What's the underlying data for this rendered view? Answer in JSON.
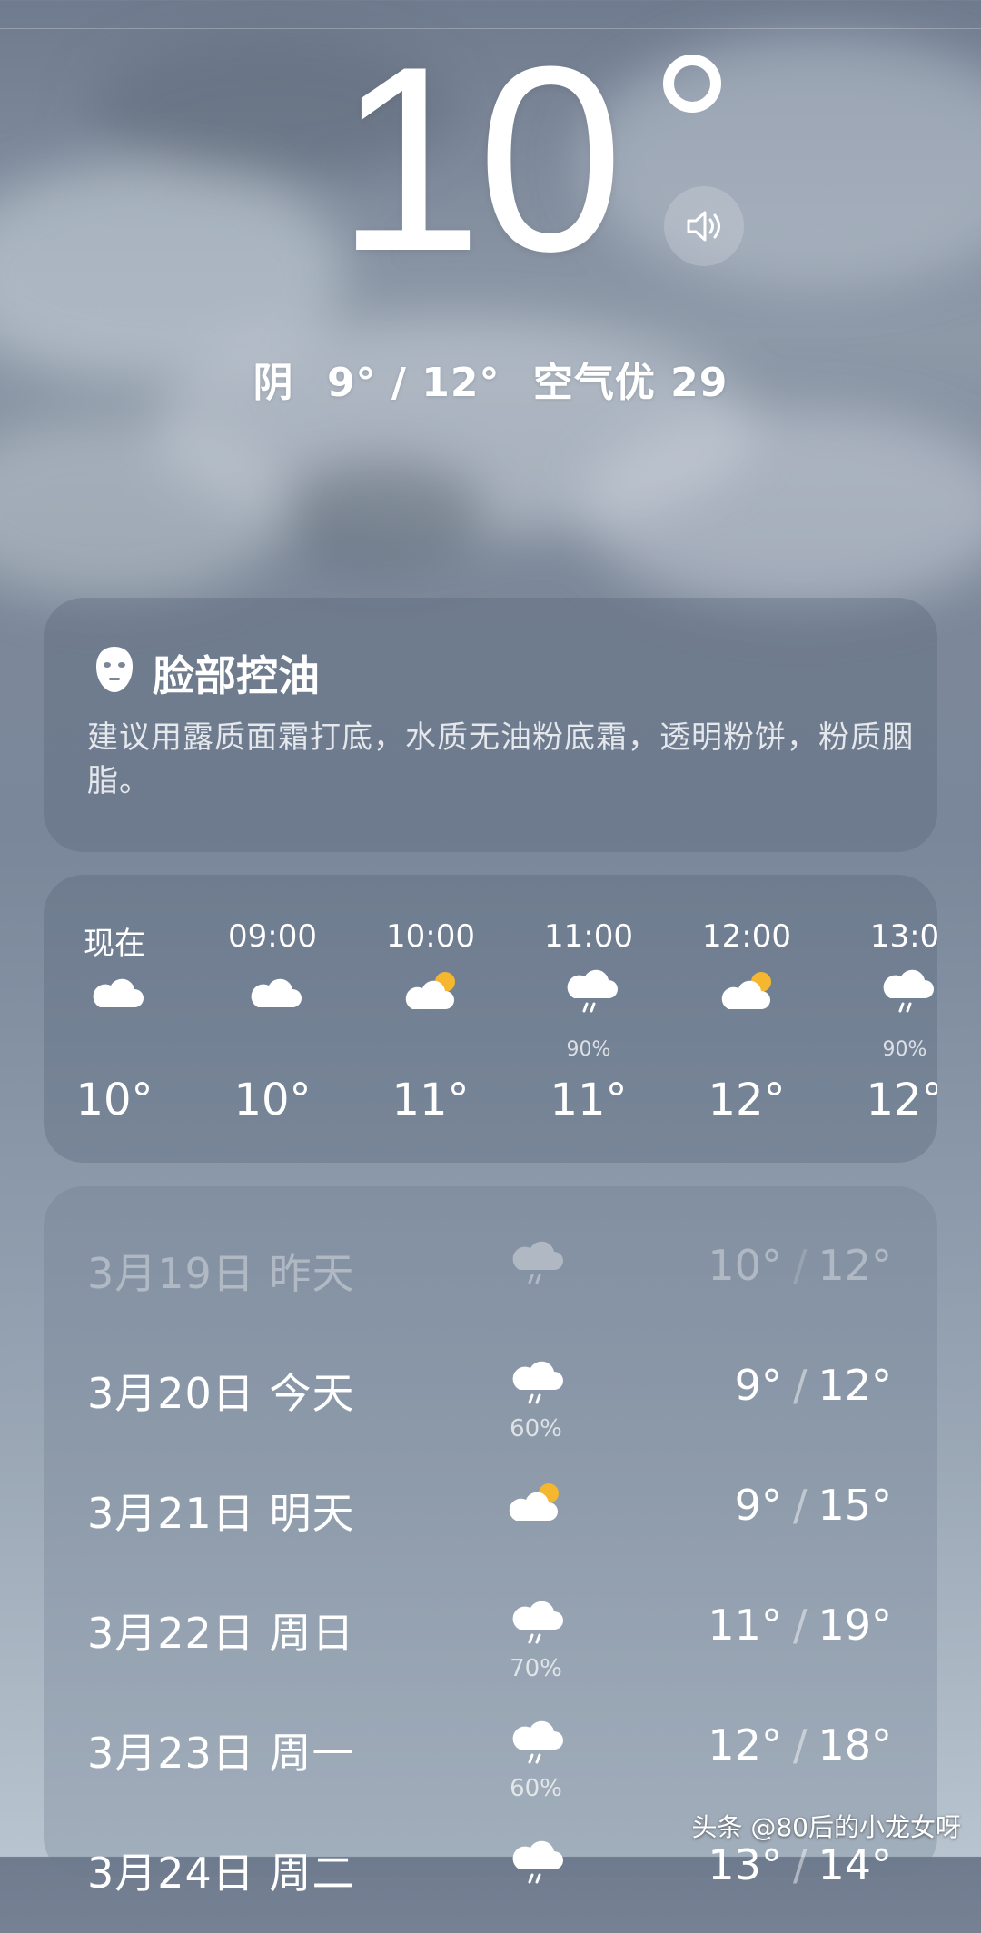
{
  "current": {
    "temperature": "10",
    "summary": {
      "condition": "阴",
      "range": "9° / 12°",
      "air": "空气优 29"
    }
  },
  "tip": {
    "title": "脸部控油",
    "text": "建议用露质面霜打底，水质无油粉底霜，透明粉饼，粉质胭脂。"
  },
  "hourly": [
    {
      "time": "现在",
      "icon": "cloud-icon",
      "pct": "",
      "temp": "10°"
    },
    {
      "time": "09:00",
      "icon": "cloud-icon",
      "pct": "",
      "temp": "10°"
    },
    {
      "time": "10:00",
      "icon": "partly-cloudy-icon",
      "pct": "",
      "temp": "11°"
    },
    {
      "time": "11:00",
      "icon": "rain-icon",
      "pct": "90%",
      "temp": "11°"
    },
    {
      "time": "12:00",
      "icon": "partly-cloudy-icon",
      "pct": "",
      "temp": "12°"
    },
    {
      "time": "13:0",
      "icon": "rain-icon",
      "pct": "90%",
      "temp": "12°"
    }
  ],
  "daily": [
    {
      "date": "3月19日",
      "day": "昨天",
      "icon": "rain-icon",
      "pct": "",
      "low": "10°",
      "high": "12°",
      "past": true
    },
    {
      "date": "3月20日",
      "day": "今天",
      "icon": "rain-icon",
      "pct": "60%",
      "low": "9°",
      "high": "12°",
      "past": false
    },
    {
      "date": "3月21日",
      "day": "明天",
      "icon": "partly-cloudy-icon",
      "pct": "",
      "low": "9°",
      "high": "15°",
      "past": false
    },
    {
      "date": "3月22日",
      "day": "周日",
      "icon": "rain-icon",
      "pct": "70%",
      "low": "11°",
      "high": "19°",
      "past": false
    },
    {
      "date": "3月23日",
      "day": "周一",
      "icon": "rain-icon",
      "pct": "60%",
      "low": "12°",
      "high": "18°",
      "past": false
    },
    {
      "date": "3月24日",
      "day": "周二",
      "icon": "rain-icon",
      "pct": "",
      "low": "13°",
      "high": "14°",
      "past": false
    }
  ],
  "watermark": "头条 @80后的小龙女呀",
  "colors": {
    "sun": "#f5b630",
    "cloud": "#ffffff"
  }
}
